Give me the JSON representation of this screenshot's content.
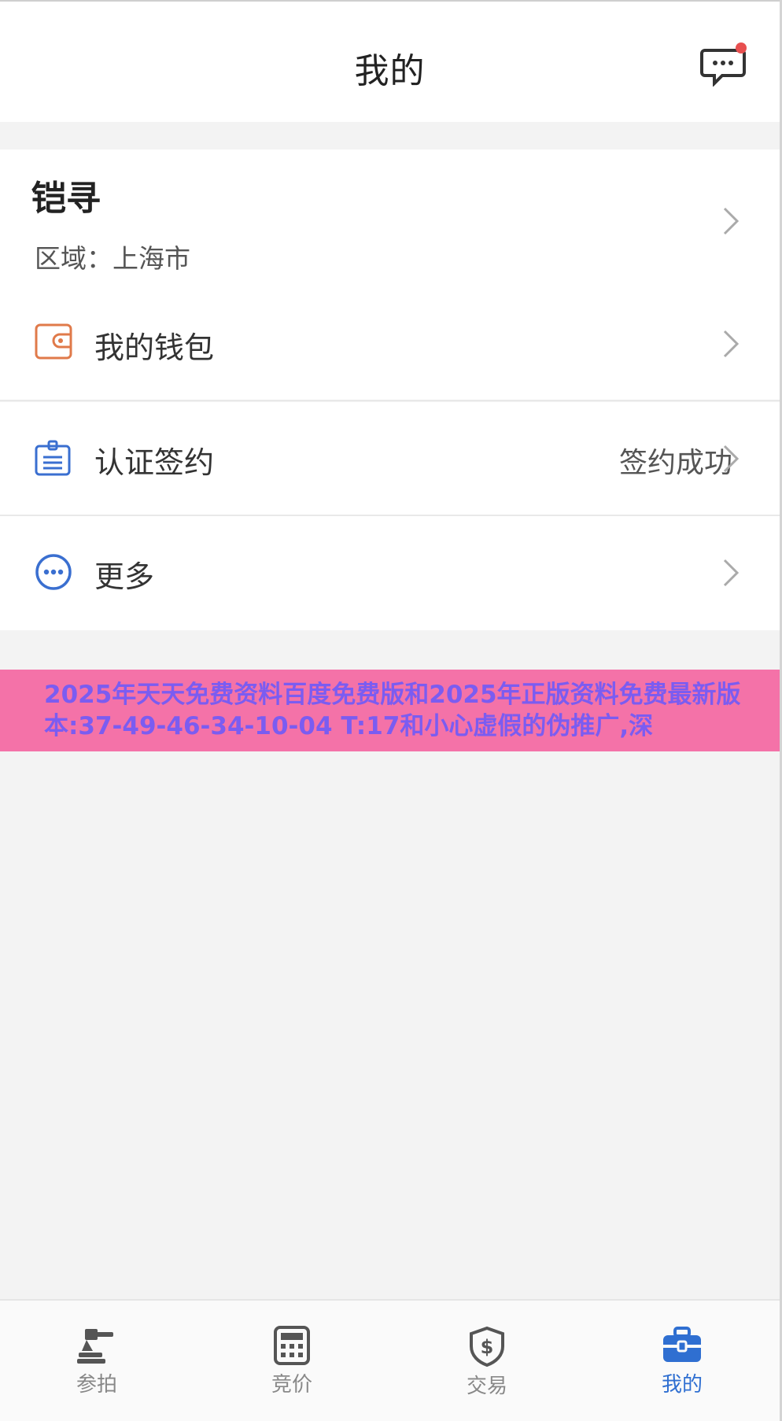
{
  "header": {
    "title": "我的"
  },
  "profile": {
    "name": "铠寻",
    "region": "区域：上海市"
  },
  "menu": {
    "wallet": {
      "label": "我的钱包"
    },
    "certification": {
      "label": "认证签约",
      "status": "签约成功"
    },
    "more": {
      "label": "更多"
    }
  },
  "banner": {
    "text": "2025年天天免费资料百度免费版和2025年正版资料免费最新版本:37-49-46-34-10-04 T:17和小心虚假的伪推广,深"
  },
  "tabs": [
    {
      "label": "参拍",
      "icon": "gavel-icon"
    },
    {
      "label": "竞价",
      "icon": "calculator-icon"
    },
    {
      "label": "交易",
      "icon": "dollar-shield-icon"
    },
    {
      "label": "我的",
      "icon": "briefcase-icon"
    }
  ],
  "colors": {
    "accent": "#2f6fd1",
    "badge": "#e84f4f",
    "wallet": "#e07a4a",
    "banner_bg": "#f472a8",
    "banner_text": "#7b5cf1"
  }
}
